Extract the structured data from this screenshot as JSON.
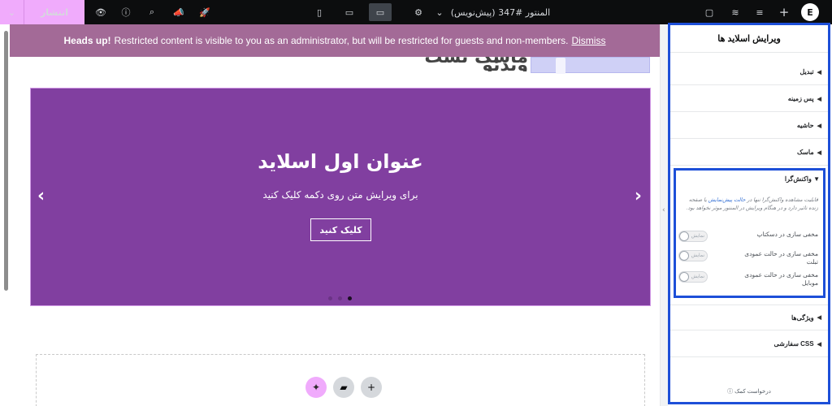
{
  "topbar": {
    "publish_label": "انتشار",
    "title": "المنتور #347 (پیش‌نویس)",
    "logo_text": "E",
    "device_active": "desktop"
  },
  "notice": {
    "bold": "Heads up!",
    "text": "Restricted content is visible to you as an administrator, but will be restricted for guests and non-members.",
    "dismiss": "Dismiss"
  },
  "page": {
    "header_title": "ماسک تست ویدئو"
  },
  "slide": {
    "title": "عنوان اول اسلاید",
    "description": "برای ویرایش متن روی دکمه کلیک کنید",
    "button": "کلیک کنید",
    "prev_arrow": "‹",
    "next_arrow": "›",
    "dots_count": 3,
    "active_dot": 3
  },
  "panel": {
    "title": "ویرایش اسلاید ها",
    "sections": {
      "transform": "تبدیل",
      "background": "پس زمینه",
      "border": "حاشیه",
      "mask": "ماسک",
      "responsive": "واکنش‌گرا",
      "attributes": "ویژگی‌ها",
      "custom_css": "CSS سفارشی"
    },
    "responsive_note_a": "قابلیت مشاهده واکنش‌گرا تنها در",
    "responsive_note_link": "حالت پیش‌نمایش",
    "responsive_note_b": "یا صفحه زنده تاثیر دارد و در هنگام ویرایش در المنتور موثر نخواهد بود.",
    "toggles": [
      {
        "label": "مخفی سازی در دسکتاپ",
        "state": "نمایش"
      },
      {
        "label": "مخفی سازی در حالت عمودی تبلت",
        "state": "نمایش"
      },
      {
        "label": "مخفی سازی در حالت عمودی موبایل",
        "state": "نمایش"
      }
    ],
    "help": "درخواست کمک"
  }
}
